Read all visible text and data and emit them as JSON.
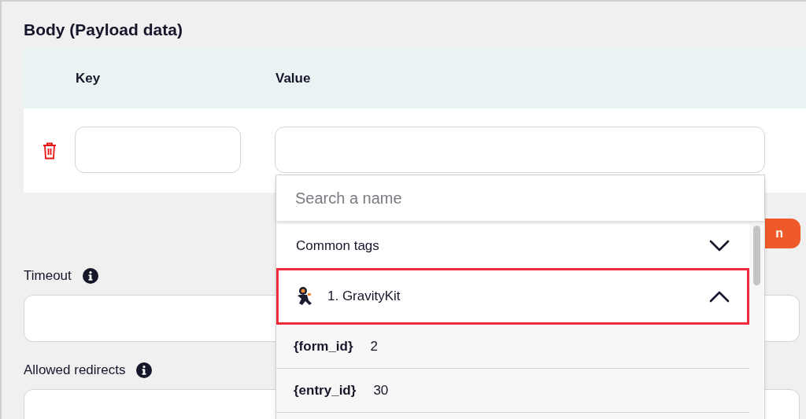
{
  "section_title": "Body (Payload data)",
  "table": {
    "columns": [
      "Key",
      "Value"
    ],
    "rows": [
      {
        "key": "",
        "value": ""
      }
    ]
  },
  "tag_dropdown": {
    "search": {
      "placeholder": "Search a name"
    },
    "groups": [
      {
        "label": "Common tags",
        "expanded": false,
        "highlighted": false,
        "has_logo": false
      },
      {
        "label": "1. GravityKit",
        "expanded": true,
        "highlighted": true,
        "has_logo": true
      }
    ],
    "tags": [
      {
        "tag": "{form_id}",
        "value": "2"
      },
      {
        "tag": "{entry_id}",
        "value": "30"
      }
    ]
  },
  "partial_button": {
    "label": "n"
  },
  "fields": [
    {
      "label": "Timeout"
    },
    {
      "label": "Allowed redirects"
    }
  ]
}
